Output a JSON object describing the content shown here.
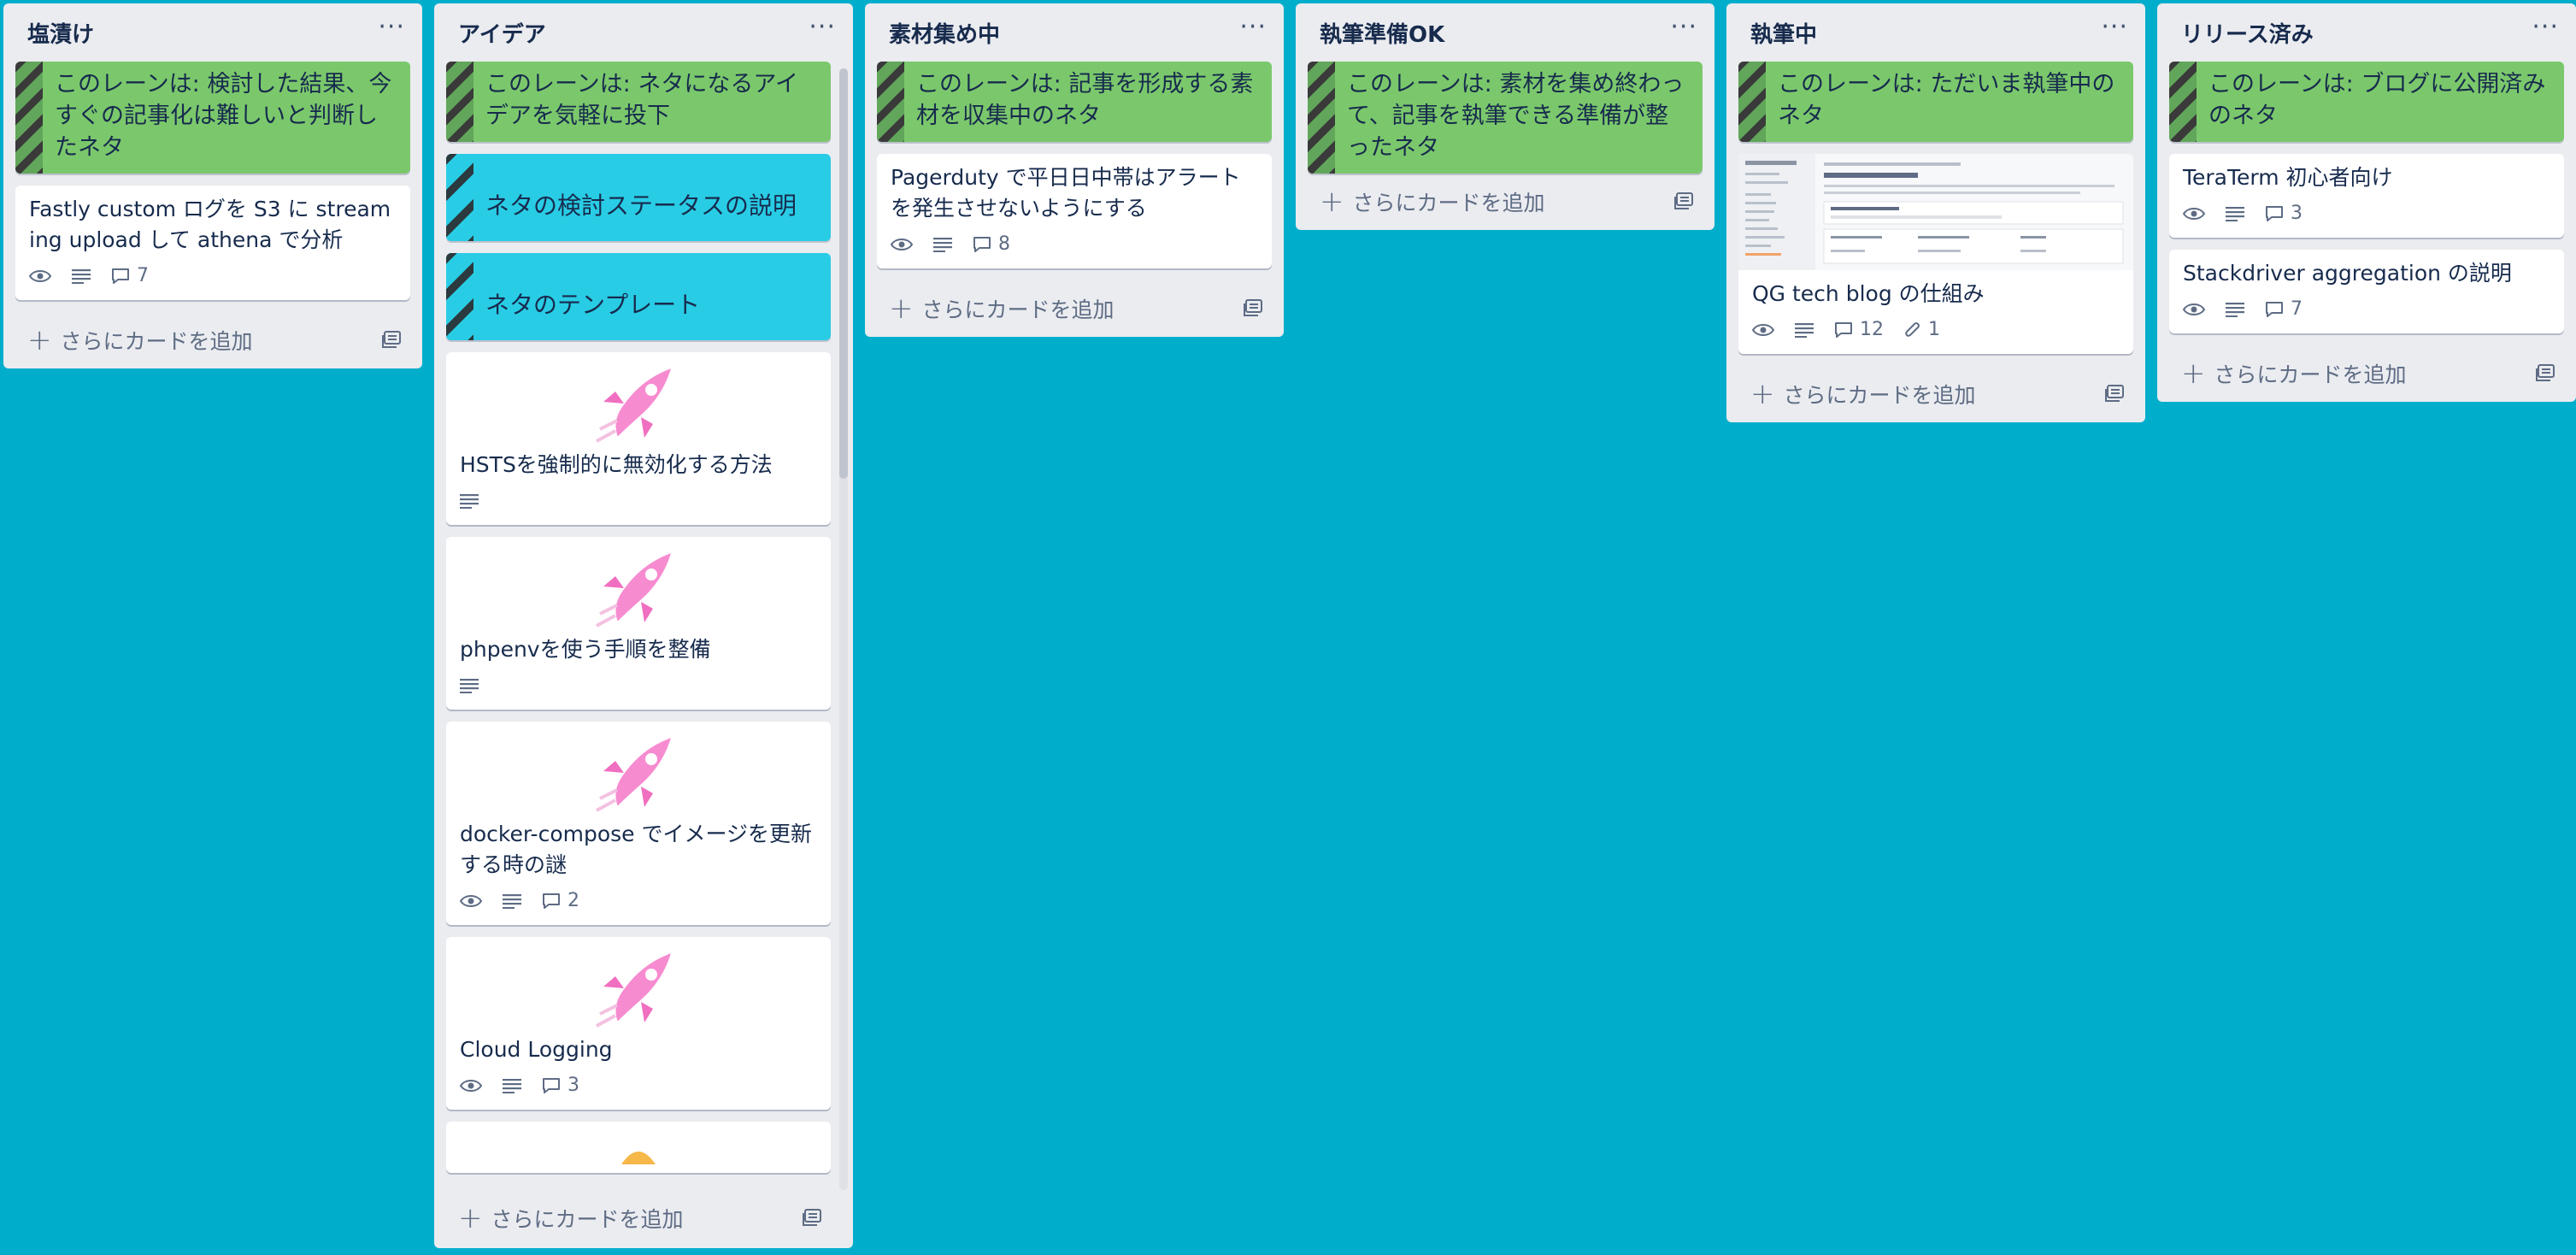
{
  "lists": [
    {
      "title": "塩漬け",
      "desc": "このレーンは: 検討した結果、今すぐの記事化は難しいと判断したネタ",
      "cards": [
        {
          "title": "Fastly custom ログを S3 に streaming upload して athena で分析",
          "comments": "7"
        }
      ],
      "add": "さらにカードを追加"
    },
    {
      "title": "アイデア",
      "desc": "このレーンは: ネタになるアイデアを気軽に投下",
      "cyan_cards": [
        "ネタの検討ステータスの説明",
        "ネタのテンプレート"
      ],
      "cards": [
        {
          "title": "HSTSを強制的に無効化する方法"
        },
        {
          "title": "phpenvを使う手順を整備"
        },
        {
          "title": "docker-compose でイメージを更新する時の謎",
          "comments": "2"
        },
        {
          "title": "Cloud Logging",
          "comments": "3"
        }
      ],
      "add": "さらにカードを追加"
    },
    {
      "title": "素材集め中",
      "desc": "このレーンは: 記事を形成する素材を収集中のネタ",
      "cards": [
        {
          "title": "Pagerduty で平日日中帯はアラートを発生させないようにする",
          "comments": "8"
        }
      ],
      "add": "さらにカードを追加"
    },
    {
      "title": "執筆準備OK",
      "desc": "このレーンは: 素材を集め終わって、記事を執筆できる準備が整ったネタ",
      "add": "さらにカードを追加"
    },
    {
      "title": "執筆中",
      "desc": "このレーンは: ただいま執筆中のネタ",
      "cards": [
        {
          "title": "QG tech blog の仕組み",
          "comments": "12",
          "attachments": "1"
        }
      ],
      "add": "さらにカードを追加"
    },
    {
      "title": "リリース済み",
      "desc": "このレーンは: ブログに公開済みのネタ",
      "cards": [
        {
          "title": "TeraTerm 初心者向け",
          "comments": "3"
        },
        {
          "title": "Stackdriver aggregation の説明",
          "comments": "7"
        }
      ],
      "add": "さらにカードを追加"
    }
  ],
  "menu_glyph": "···",
  "colors": {
    "board_bg": "#00aecc",
    "list_bg": "#ebecf0",
    "desc_green": "#7bc86c",
    "desc_cyan": "#29cce5",
    "sticker_pink": "#f78bd0"
  },
  "icons": [
    "eye-icon",
    "description-icon",
    "comment-icon",
    "attachment-icon",
    "template-card-icon",
    "rocket-sticker"
  ]
}
